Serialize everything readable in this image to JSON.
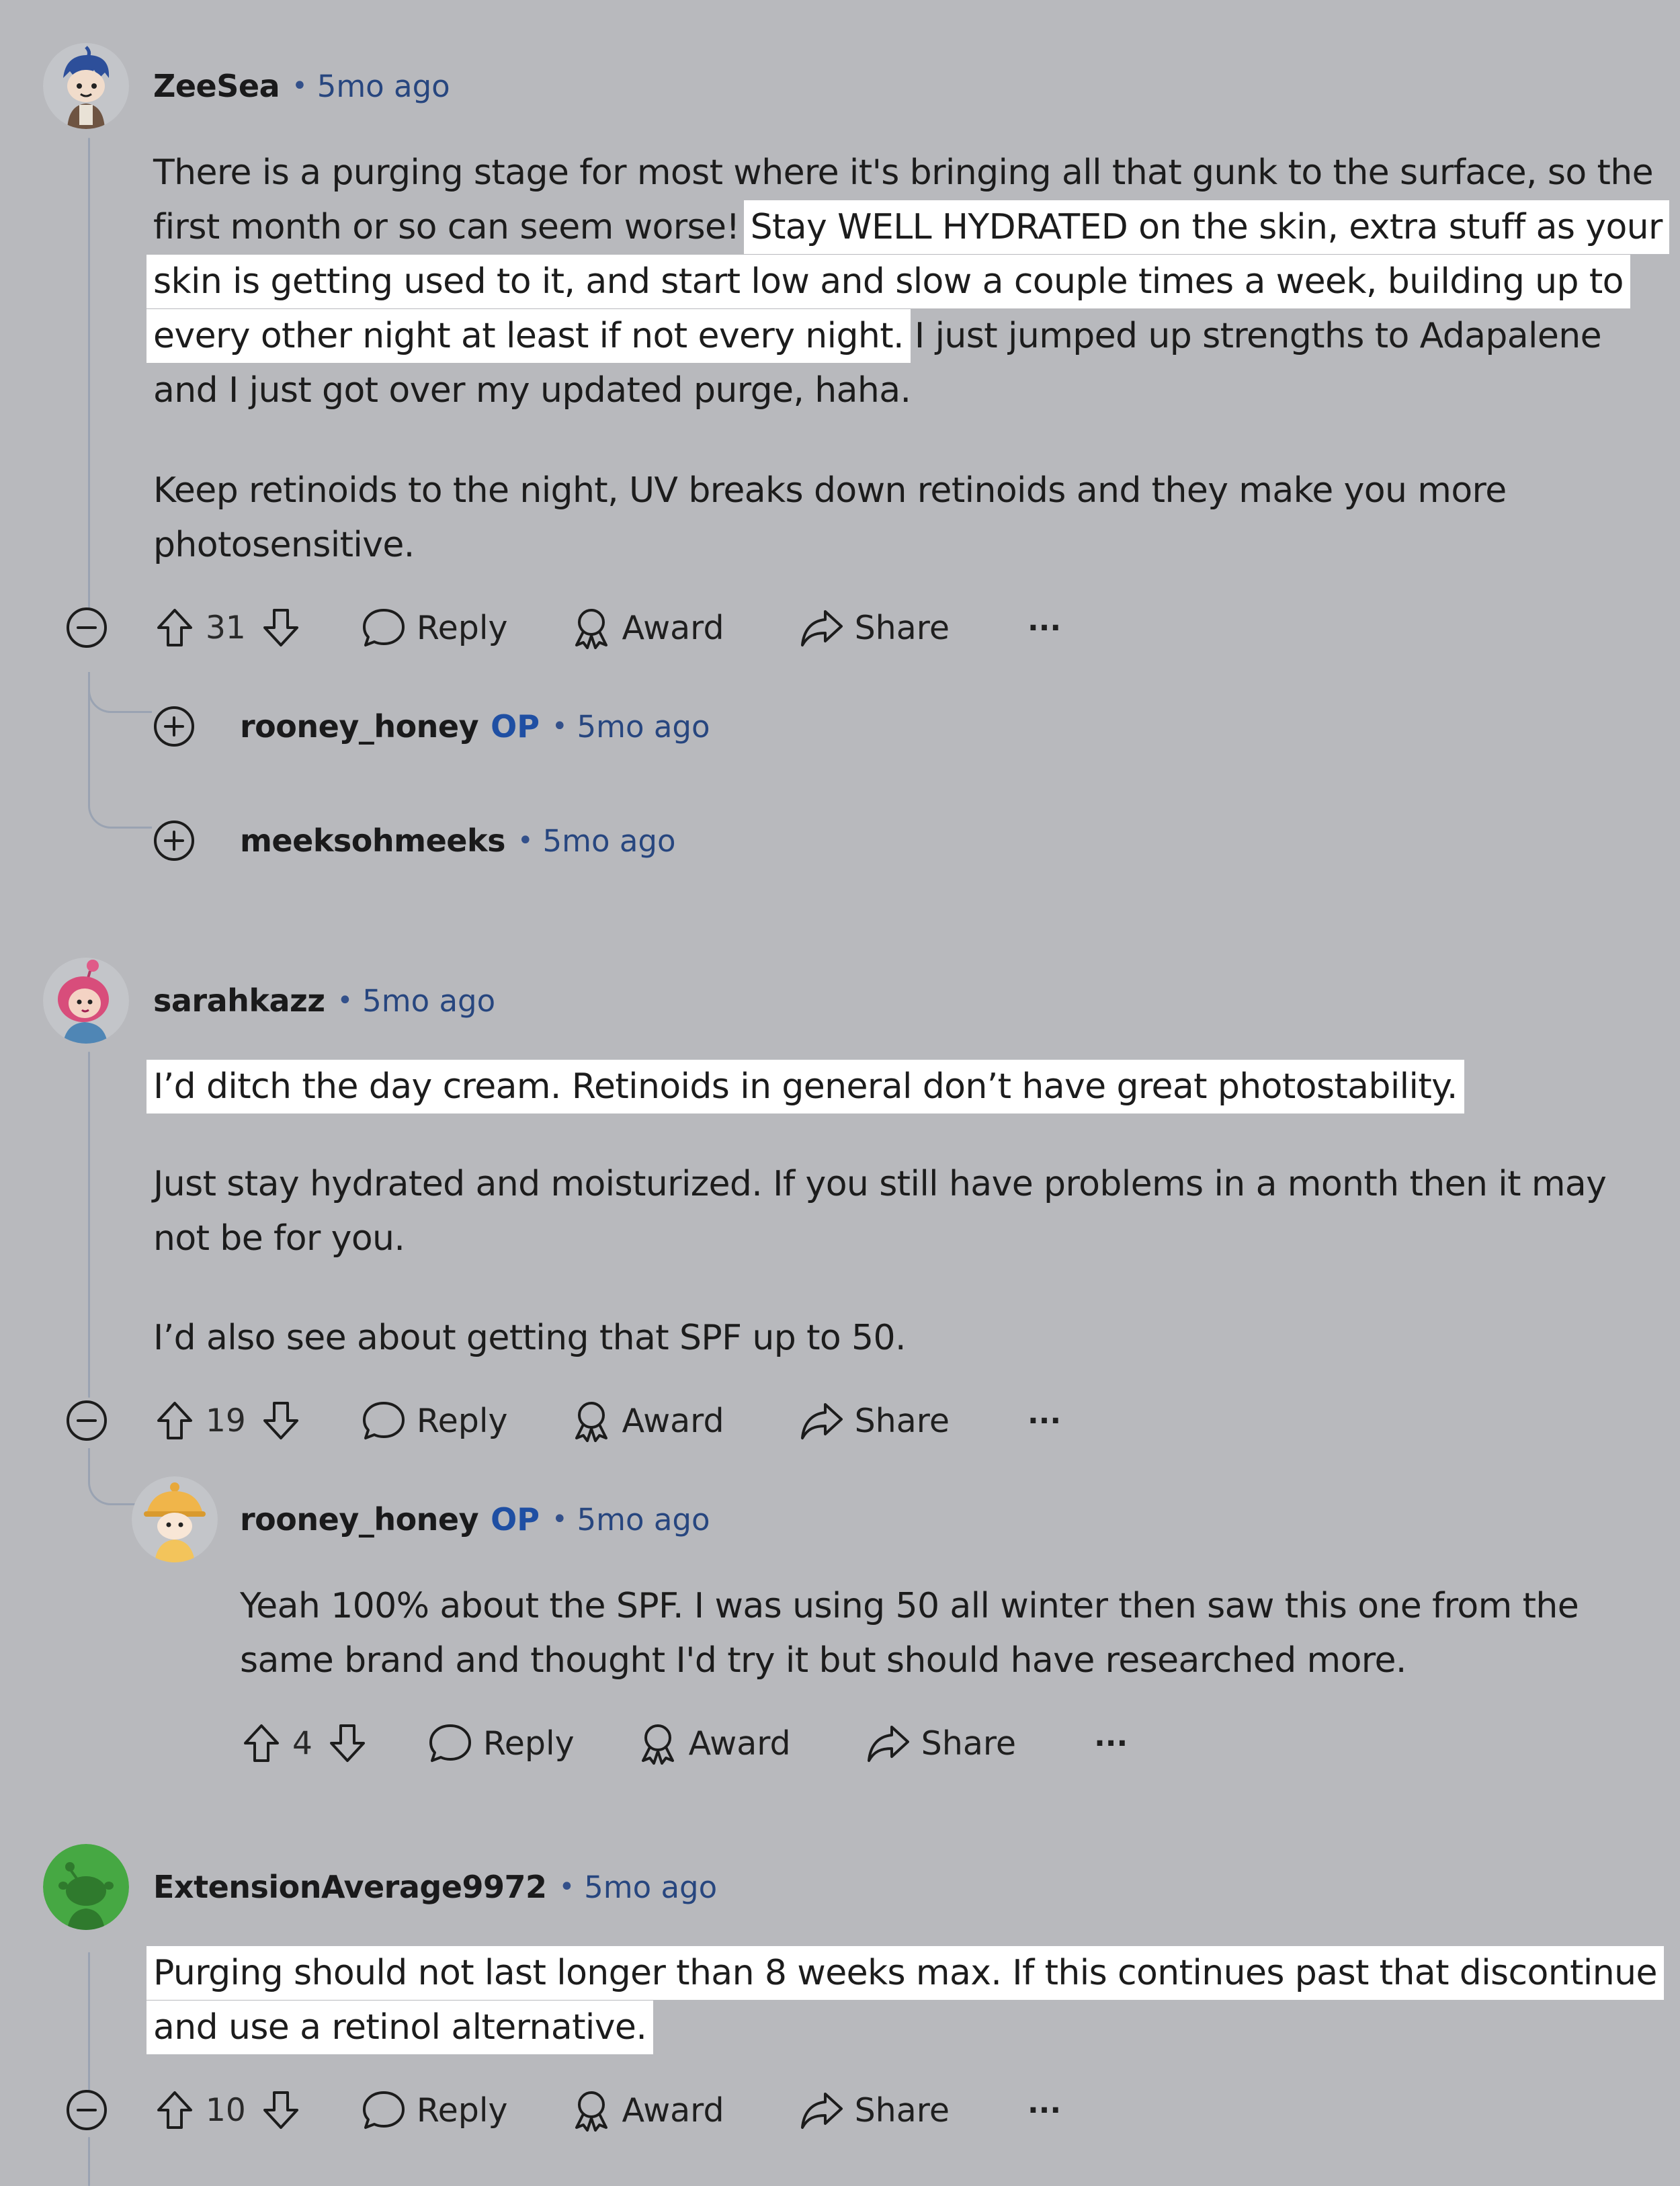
{
  "comments": [
    {
      "user": "ZeeSea",
      "dot": "•",
      "time": "5mo ago",
      "lines": [
        [
          "There is a purging stage for most where it's bringing all that gunk to the surface, so the"
        ],
        [
          "first month or so can seem worse! ",
          "Stay WELL HYDRATED on the skin, extra stuff as your"
        ],
        [
          "",
          "skin is getting used to it, and start low and slow a couple times a week, building up to"
        ],
        [
          "",
          "every other night at least if not every night.",
          " I just jumped up strengths to Adapalene"
        ],
        [
          "and I just got over my updated purge, haha."
        ]
      ],
      "lines2": [
        "Keep retinoids to the night, UV breaks down retinoids and they make you more",
        "photosensitive."
      ],
      "votes": "31",
      "collapsed_replies": [
        {
          "user": "rooney_honey",
          "op": "OP",
          "time": "5mo ago"
        },
        {
          "user": "meeksohmeeks",
          "time": "5mo ago"
        }
      ]
    },
    {
      "user": "sarahkazz",
      "dot": "•",
      "time": "5mo ago",
      "highlight": "I’d ditch the day cream. Retinoids in general don’t have great photostability.",
      "para2": [
        "Just stay hydrated and moisturized. If you still have problems in a month then it may",
        "not be for you."
      ],
      "para3": "I’d also see about getting that SPF up to 50.",
      "votes": "19",
      "reply": {
        "user": "rooney_honey",
        "op": "OP",
        "time": "5mo ago",
        "lines": [
          "Yeah 100% about the SPF. I was using 50 all winter then saw this one from the",
          "same brand and thought I'd try it but should have researched more."
        ],
        "votes": "4"
      }
    },
    {
      "user": "ExtensionAverage9972",
      "dot": "•",
      "time": "5mo ago",
      "lines": [
        "Purging should not last longer than 8 weeks max. If this continues past that discontinue",
        "and use a retinol alternative."
      ],
      "votes": "10"
    }
  ],
  "actions": {
    "reply": "Reply",
    "award": "Award",
    "share": "Share",
    "more": "···"
  },
  "icons": {
    "upvote": "upvote-arrow-icon",
    "downvote": "downvote-arrow-icon",
    "reply": "speech-bubble-icon",
    "award": "award-ribbon-icon",
    "share": "share-arrow-icon",
    "collapse": "minus-circle-icon",
    "expand": "plus-circle-icon"
  },
  "colors": {
    "background": "#b8b9bd",
    "highlight": "#ffffff",
    "op_label": "#1f4fa3",
    "timestamp": "#27467f"
  }
}
